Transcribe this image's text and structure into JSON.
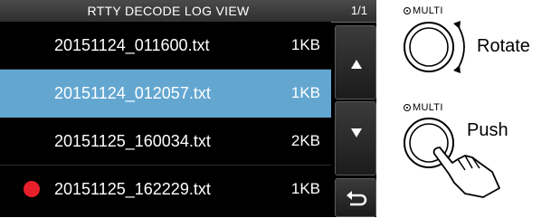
{
  "screen": {
    "title": "RTTY DECODE LOG VIEW",
    "page_indicator": "1/1",
    "files": [
      {
        "name": "20151124_011600.txt",
        "size": "1KB",
        "selected": false,
        "recording": false
      },
      {
        "name": "20151124_012057.txt",
        "size": "1KB",
        "selected": true,
        "recording": false
      },
      {
        "name": "20151125_160034.txt",
        "size": "2KB",
        "selected": false,
        "recording": false
      },
      {
        "name": "20151125_162229.txt",
        "size": "1KB",
        "selected": false,
        "recording": true
      }
    ],
    "side_buttons": {
      "up_icon": "triangle-up-icon",
      "down_icon": "triangle-down-icon",
      "back_icon": "return-arrow-icon"
    },
    "colors": {
      "selected_row": "#63a7d1",
      "recording_dot": "#e8202a",
      "background": "#000000"
    }
  },
  "illustration": {
    "rotate": {
      "dial_label": "MULTI",
      "action": "Rotate"
    },
    "push": {
      "dial_label": "MULTI",
      "action": "Push"
    }
  }
}
